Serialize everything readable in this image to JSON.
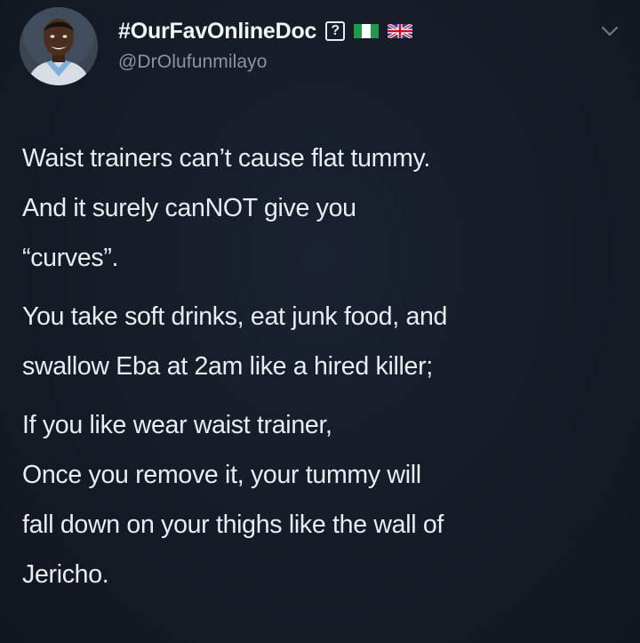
{
  "tweet": {
    "display_name": "#OurFavOnlineDoc",
    "badge_glyph": "?",
    "handle": "@DrOlufunmilayo",
    "icons": {
      "avatar": "profile-photo",
      "badge": "question-box-icon",
      "flag_1": "nigeria-flag-icon",
      "flag_2": "uk-flag-icon",
      "menu": "chevron-down-icon"
    },
    "paragraphs": [
      {
        "lines": [
          "Waist trainers can’t cause flat tummy.",
          "And it surely canNOT give you",
          "“curves”."
        ]
      },
      {
        "lines": [
          "You take soft drinks, eat junk food, and",
          "swallow Eba at 2am like a hired killer;"
        ]
      },
      {
        "lines": [
          "If you like wear waist trainer,",
          "Once you remove it, your tummy will",
          "fall down on your thighs like the wall of",
          "Jericho."
        ]
      }
    ]
  },
  "colors": {
    "background": "#151b26",
    "text": "#e9ecf0",
    "handle": "#8a94a2",
    "nigeria_green": "#1f9a4a",
    "uk_blue": "#2a3d8f",
    "uk_red": "#c8102e"
  }
}
